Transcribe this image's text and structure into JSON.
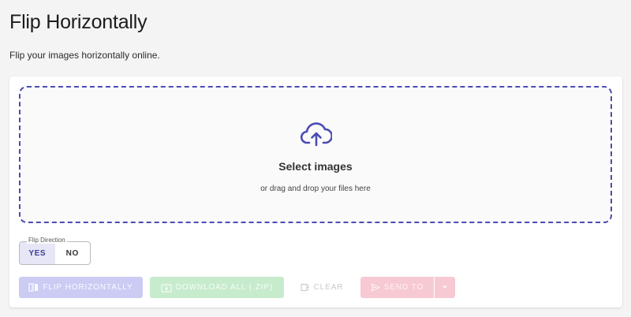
{
  "header": {
    "title": "Flip Horizontally",
    "subtitle": "Flip your images horizontally online."
  },
  "dropzone": {
    "title": "Select images",
    "subtitle": "or drag and drop your files here",
    "icon": "cloud-upload-icon"
  },
  "flip_direction": {
    "legend": "Flip Direction",
    "options": [
      "YES",
      "NO"
    ],
    "selected": "YES"
  },
  "actions": {
    "flip_label": "FLIP HORIZONTALLY",
    "download_label": "DOWNLOAD ALL (.ZIP)",
    "clear_label": "CLEAR",
    "send_label": "SEND TO"
  },
  "colors": {
    "accent": "#4b4bb5",
    "flip_button": "#cbcbf3",
    "download_button": "#c7ebcd",
    "send_button": "#f7c9d3"
  }
}
